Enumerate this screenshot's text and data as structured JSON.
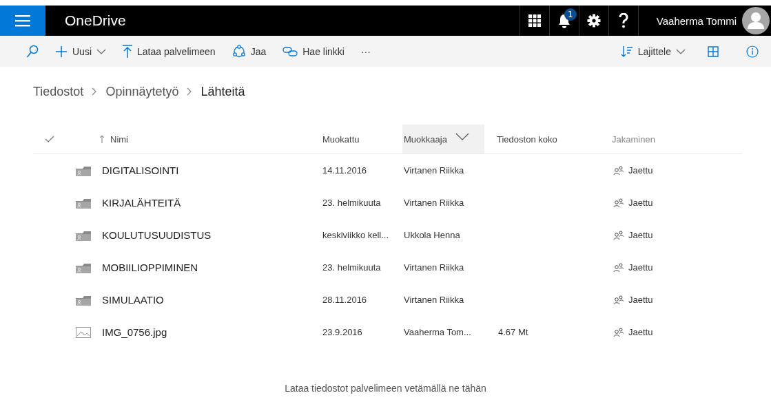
{
  "app_title": "OneDrive",
  "notifications": {
    "count": "1"
  },
  "user": {
    "name": "Vaaherma Tommi"
  },
  "toolbar": {
    "left": [
      {
        "kind": "new",
        "label": "Uusi"
      },
      {
        "kind": "upload",
        "label": "Lataa palvelimeen"
      },
      {
        "kind": "share",
        "label": "Jaa"
      },
      {
        "kind": "link",
        "label": "Hae linkki"
      },
      {
        "kind": "more",
        "label": "···"
      }
    ],
    "sort": {
      "label": "Lajittele"
    }
  },
  "breadcrumb": [
    "Tiedostot",
    "Opinnäytetyö",
    "Lähteitä"
  ],
  "table": {
    "columns": [
      {
        "label": "Nimi",
        "highlighted": false
      },
      {
        "label": "Muokattu",
        "highlighted": false
      },
      {
        "label": "Muokkaaja",
        "highlighted": true
      },
      {
        "label": "Tiedoston koko",
        "highlighted": false
      },
      {
        "label": "Jakaminen",
        "highlighted": false
      }
    ],
    "rows": [
      {
        "kind": "folder",
        "name": "DIGITALISOINTI",
        "modified": "14.11.2016",
        "modified_by": "Virtanen Riikka",
        "sharing": "Jaettu"
      },
      {
        "kind": "folder",
        "name": "KIRJALÄHTEITÄ",
        "modified": "23. helmikuuta",
        "modified_by": "Virtanen Riikka",
        "sharing": "Jaettu"
      },
      {
        "kind": "folder",
        "name": "KOULUTUSUUDISTUS",
        "modified": "keskiviikko kell...",
        "modified_by": "Ukkola Henna",
        "sharing": "Jaettu"
      },
      {
        "kind": "folder",
        "name": "MOBIILIOPPIMINEN",
        "modified": "23. helmikuuta",
        "modified_by": "Virtanen Riikka",
        "sharing": "Jaettu"
      },
      {
        "kind": "folder",
        "name": "SIMULAATIO",
        "modified": "28.11.2016",
        "modified_by": "Virtanen Riikka",
        "sharing": "Jaettu"
      },
      {
        "kind": "image",
        "name": "IMG_0756.jpg",
        "modified": "23.9.2016",
        "modified_by": "Vaaherma Tom...",
        "size": "4.67 Mt",
        "sharing": "Jaettu"
      }
    ]
  },
  "drop_hint": "Lataa tiedostot palvelimeen vetämällä ne tähän"
}
